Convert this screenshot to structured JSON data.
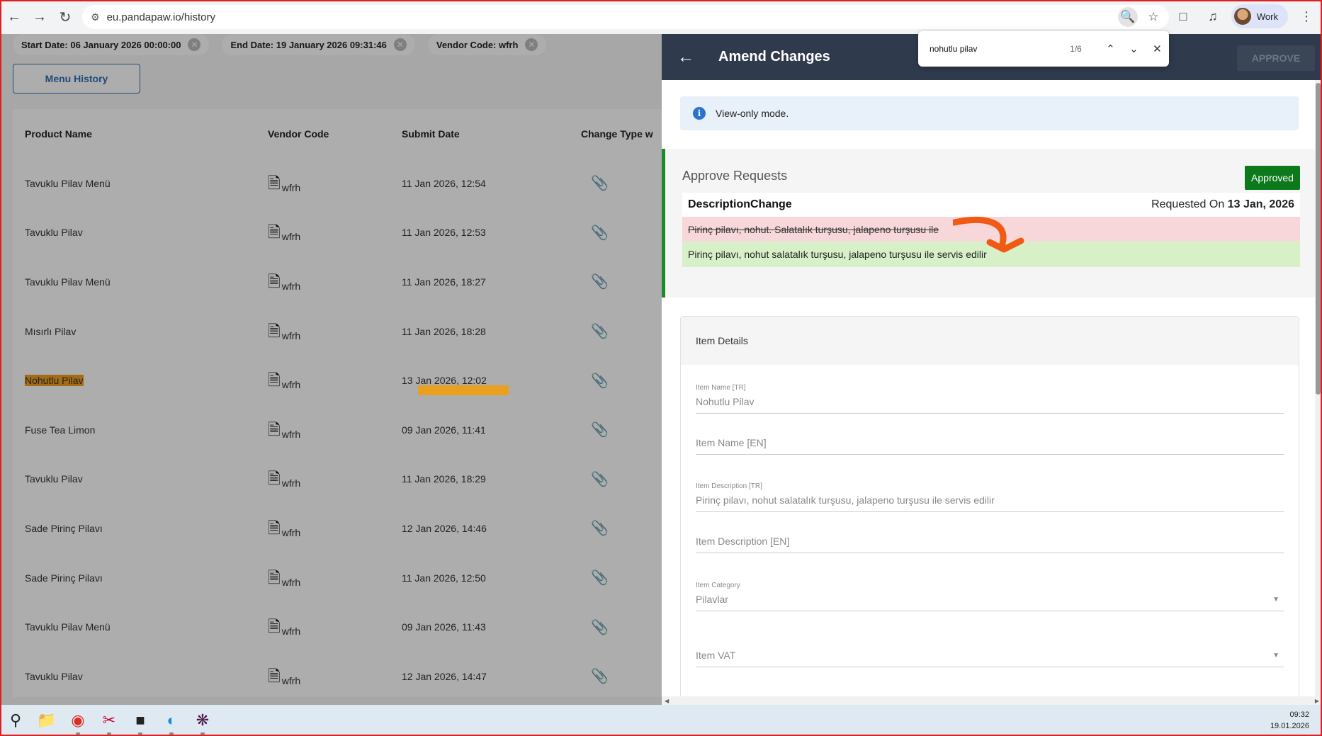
{
  "browser": {
    "url": "eu.pandapaw.io/history",
    "profile_label": "Work"
  },
  "filters": [
    {
      "label": "Start Date: 06 January 2026 00:00:00"
    },
    {
      "label": "End Date: 19 January 2026 09:31:46"
    },
    {
      "label": "Vendor Code: wfrh"
    }
  ],
  "menu_history_label": "Menu History",
  "table": {
    "headers": [
      "Product Name",
      "Vendor Code",
      "Submit Date",
      "Change Type w"
    ],
    "rows": [
      {
        "name": "Tavuklu Pilav Menü",
        "vendor": "wfrh",
        "date": "11 Jan 2026, 12:54"
      },
      {
        "name": "Tavuklu Pilav",
        "vendor": "wfrh",
        "date": "11 Jan 2026, 12:53"
      },
      {
        "name": "Tavuklu Pilav Menü",
        "vendor": "wfrh",
        "date": "11 Jan 2026, 18:27"
      },
      {
        "name": "Mısırlı Pilav",
        "vendor": "wfrh",
        "date": "11 Jan 2026, 18:28"
      },
      {
        "name": "Nohutlu Pilav",
        "vendor": "wfrh",
        "date": "13 Jan 2026, 12:02"
      },
      {
        "name": "Fuse Tea Limon",
        "vendor": "wfrh",
        "date": "09 Jan 2026, 11:41"
      },
      {
        "name": "Tavuklu Pilav",
        "vendor": "wfrh",
        "date": "11 Jan 2026, 18:29"
      },
      {
        "name": "Sade Pirinç Pilavı",
        "vendor": "wfrh",
        "date": "12 Jan 2026, 14:46"
      },
      {
        "name": "Sade Pirinç Pilavı",
        "vendor": "wfrh",
        "date": "11 Jan 2026, 12:50"
      },
      {
        "name": "Tavuklu Pilav Menü",
        "vendor": "wfrh",
        "date": "09 Jan 2026, 11:43"
      },
      {
        "name": "Tavuklu Pilav",
        "vendor": "wfrh",
        "date": "12 Jan 2026, 14:47"
      }
    ]
  },
  "drawer": {
    "title": "Amend Changes",
    "approve_label": "APPROVE",
    "info_text": "View-only mode.",
    "approve_requests_title": "Approve Requests",
    "status": "Approved",
    "change_type": "DescriptionChange",
    "requested_prefix": "Requested On",
    "requested_date": "13 Jan, 2026",
    "old_value": "Pirinç pilavı, nohut. Salatalık turşusu, jalapeno turşusu ile",
    "new_value": "Pirinç pilavı, nohut salatalık turşusu, jalapeno turşusu ile servis edilir",
    "details_title": "Item Details",
    "fields": {
      "item_name_tr_label": "Item Name [TR]",
      "item_name_tr_value": "Nohutlu Pilav",
      "item_name_en_label": "Item Name [EN]",
      "item_desc_tr_label": "Item Description [TR]",
      "item_desc_tr_value": "Pirinç pilavı, nohut salatalık turşusu, jalapeno turşusu ile servis edilir",
      "item_desc_en_label": "Item Description [EN]",
      "item_category_label": "Item Category",
      "item_category_value": "Pilavlar",
      "item_vat_label": "Item VAT"
    }
  },
  "find": {
    "query": "nohutlu pilav",
    "count": "1/6"
  },
  "taskbar": {
    "time": "09:32",
    "date": "19.01.2026"
  },
  "colors": {
    "drawer_header": "#2f3b4c",
    "approved_green": "#0c7a1c",
    "old_value_bg": "#f7d7d9",
    "new_value_bg": "#d8f0c8",
    "highlight": "#f0a020",
    "annotation": "#f05a14"
  }
}
